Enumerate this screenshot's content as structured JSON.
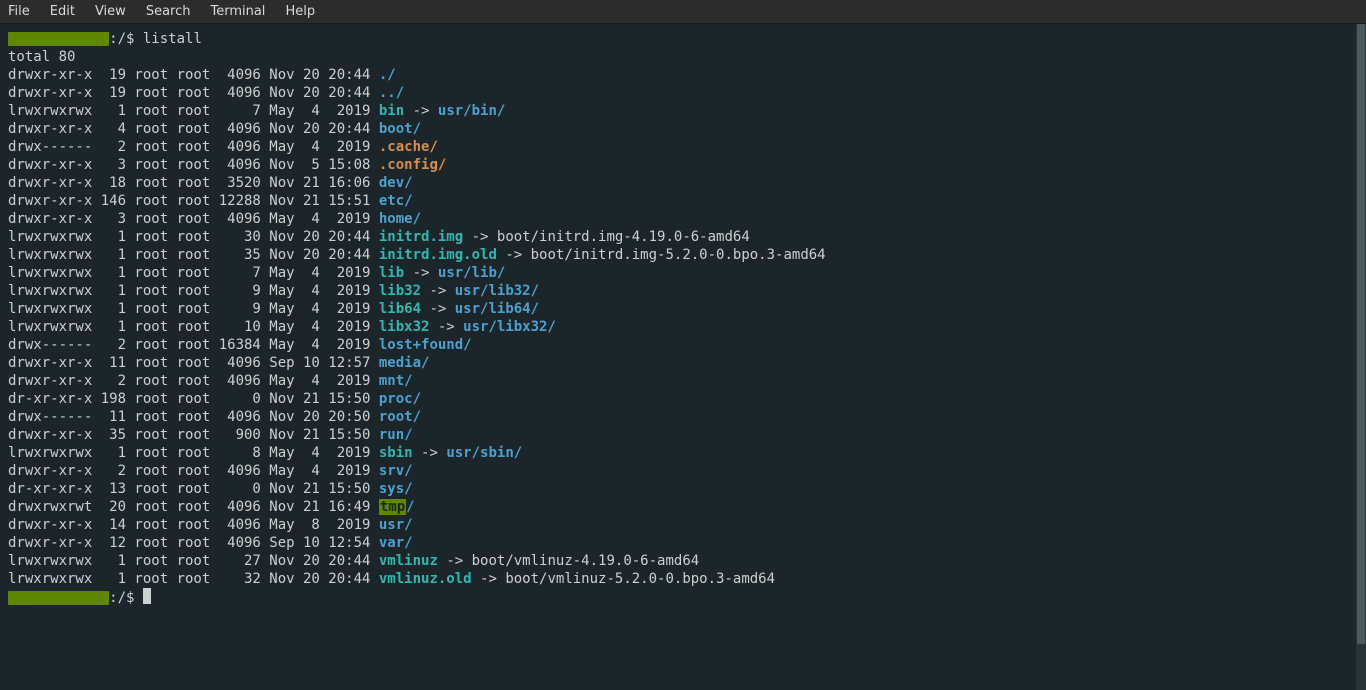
{
  "menu": [
    "File",
    "Edit",
    "View",
    "Search",
    "Terminal",
    "Help"
  ],
  "prompt": {
    "path": ":/$ ",
    "cmd": "listall"
  },
  "total": "total 80",
  "rows": [
    {
      "perm": "drwxr-xr-x",
      "n": "19",
      "u": "root",
      "g": "root",
      "sz": "4096",
      "date": "Nov 20 20:44",
      "name": "./",
      "kind": "dir"
    },
    {
      "perm": "drwxr-xr-x",
      "n": "19",
      "u": "root",
      "g": "root",
      "sz": "4096",
      "date": "Nov 20 20:44",
      "name": "../",
      "kind": "dir"
    },
    {
      "perm": "lrwxrwxrwx",
      "n": "1",
      "u": "root",
      "g": "root",
      "sz": "7",
      "date": "May  4  2019",
      "name": "bin",
      "kind": "link",
      "arrow": " -> ",
      "target": "usr/bin/",
      "tgt": "dir"
    },
    {
      "perm": "drwxr-xr-x",
      "n": "4",
      "u": "root",
      "g": "root",
      "sz": "4096",
      "date": "Nov 20 20:44",
      "name": "boot/",
      "kind": "dir"
    },
    {
      "perm": "drwx------",
      "n": "2",
      "u": "root",
      "g": "root",
      "sz": "4096",
      "date": "May  4  2019",
      "name": ".cache/",
      "kind": "dir-orange"
    },
    {
      "perm": "drwxr-xr-x",
      "n": "3",
      "u": "root",
      "g": "root",
      "sz": "4096",
      "date": "Nov  5 15:08",
      "name": ".config/",
      "kind": "dir-orange"
    },
    {
      "perm": "drwxr-xr-x",
      "n": "18",
      "u": "root",
      "g": "root",
      "sz": "3520",
      "date": "Nov 21 16:06",
      "name": "dev/",
      "kind": "dir"
    },
    {
      "perm": "drwxr-xr-x",
      "n": "146",
      "u": "root",
      "g": "root",
      "sz": "12288",
      "date": "Nov 21 15:51",
      "name": "etc/",
      "kind": "dir"
    },
    {
      "perm": "drwxr-xr-x",
      "n": "3",
      "u": "root",
      "g": "root",
      "sz": "4096",
      "date": "May  4  2019",
      "name": "home/",
      "kind": "dir"
    },
    {
      "perm": "lrwxrwxrwx",
      "n": "1",
      "u": "root",
      "g": "root",
      "sz": "30",
      "date": "Nov 20 20:44",
      "name": "initrd.img",
      "kind": "link",
      "arrow": " -> ",
      "target": "boot/initrd.img-4.19.0-6-amd64",
      "tgt": "plain"
    },
    {
      "perm": "lrwxrwxrwx",
      "n": "1",
      "u": "root",
      "g": "root",
      "sz": "35",
      "date": "Nov 20 20:44",
      "name": "initrd.img.old",
      "kind": "link",
      "arrow": " -> ",
      "target": "boot/initrd.img-5.2.0-0.bpo.3-amd64",
      "tgt": "plain"
    },
    {
      "perm": "lrwxrwxrwx",
      "n": "1",
      "u": "root",
      "g": "root",
      "sz": "7",
      "date": "May  4  2019",
      "name": "lib",
      "kind": "link",
      "arrow": " -> ",
      "target": "usr/lib/",
      "tgt": "dir"
    },
    {
      "perm": "lrwxrwxrwx",
      "n": "1",
      "u": "root",
      "g": "root",
      "sz": "9",
      "date": "May  4  2019",
      "name": "lib32",
      "kind": "link",
      "arrow": " -> ",
      "target": "usr/lib32/",
      "tgt": "dir"
    },
    {
      "perm": "lrwxrwxrwx",
      "n": "1",
      "u": "root",
      "g": "root",
      "sz": "9",
      "date": "May  4  2019",
      "name": "lib64",
      "kind": "link",
      "arrow": " -> ",
      "target": "usr/lib64/",
      "tgt": "dir"
    },
    {
      "perm": "lrwxrwxrwx",
      "n": "1",
      "u": "root",
      "g": "root",
      "sz": "10",
      "date": "May  4  2019",
      "name": "libx32",
      "kind": "link",
      "arrow": " -> ",
      "target": "usr/libx32/",
      "tgt": "dir"
    },
    {
      "perm": "drwx------",
      "n": "2",
      "u": "root",
      "g": "root",
      "sz": "16384",
      "date": "May  4  2019",
      "name": "lost+found/",
      "kind": "dir"
    },
    {
      "perm": "drwxr-xr-x",
      "n": "11",
      "u": "root",
      "g": "root",
      "sz": "4096",
      "date": "Sep 10 12:57",
      "name": "media/",
      "kind": "dir"
    },
    {
      "perm": "drwxr-xr-x",
      "n": "2",
      "u": "root",
      "g": "root",
      "sz": "4096",
      "date": "May  4  2019",
      "name": "mnt/",
      "kind": "dir"
    },
    {
      "perm": "dr-xr-xr-x",
      "n": "198",
      "u": "root",
      "g": "root",
      "sz": "0",
      "date": "Nov 21 15:50",
      "name": "proc/",
      "kind": "dir"
    },
    {
      "perm": "drwx------",
      "n": "11",
      "u": "root",
      "g": "root",
      "sz": "4096",
      "date": "Nov 20 20:50",
      "name": "root/",
      "kind": "dir"
    },
    {
      "perm": "drwxr-xr-x",
      "n": "35",
      "u": "root",
      "g": "root",
      "sz": "900",
      "date": "Nov 21 15:50",
      "name": "run/",
      "kind": "dir"
    },
    {
      "perm": "lrwxrwxrwx",
      "n": "1",
      "u": "root",
      "g": "root",
      "sz": "8",
      "date": "May  4  2019",
      "name": "sbin",
      "kind": "link",
      "arrow": " -> ",
      "target": "usr/sbin/",
      "tgt": "dir"
    },
    {
      "perm": "drwxr-xr-x",
      "n": "2",
      "u": "root",
      "g": "root",
      "sz": "4096",
      "date": "May  4  2019",
      "name": "srv/",
      "kind": "dir"
    },
    {
      "perm": "dr-xr-xr-x",
      "n": "13",
      "u": "root",
      "g": "root",
      "sz": "0",
      "date": "Nov 21 15:50",
      "name": "sys/",
      "kind": "dir"
    },
    {
      "perm": "drwxrwxrwt",
      "n": "20",
      "u": "root",
      "g": "root",
      "sz": "4096",
      "date": "Nov 21 16:49",
      "name": "tmp",
      "kind": "tmp",
      "slash": "/"
    },
    {
      "perm": "drwxr-xr-x",
      "n": "14",
      "u": "root",
      "g": "root",
      "sz": "4096",
      "date": "May  8  2019",
      "name": "usr/",
      "kind": "dir"
    },
    {
      "perm": "drwxr-xr-x",
      "n": "12",
      "u": "root",
      "g": "root",
      "sz": "4096",
      "date": "Sep 10 12:54",
      "name": "var/",
      "kind": "dir"
    },
    {
      "perm": "lrwxrwxrwx",
      "n": "1",
      "u": "root",
      "g": "root",
      "sz": "27",
      "date": "Nov 20 20:44",
      "name": "vmlinuz",
      "kind": "link",
      "arrow": " -> ",
      "target": "boot/vmlinuz-4.19.0-6-amd64",
      "tgt": "plain"
    },
    {
      "perm": "lrwxrwxrwx",
      "n": "1",
      "u": "root",
      "g": "root",
      "sz": "32",
      "date": "Nov 20 20:44",
      "name": "vmlinuz.old",
      "kind": "link",
      "arrow": " -> ",
      "target": "boot/vmlinuz-5.2.0-0.bpo.3-amd64",
      "tgt": "plain"
    }
  ]
}
